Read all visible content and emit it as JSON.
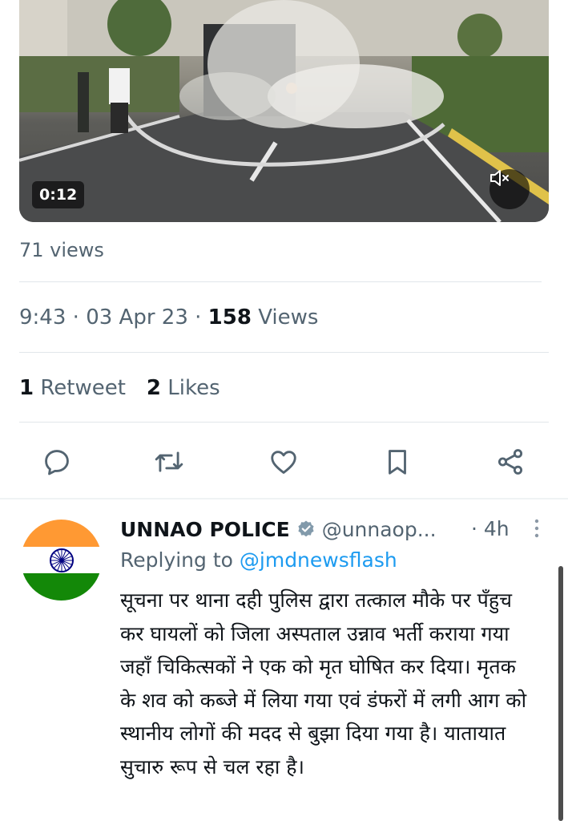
{
  "video": {
    "timer": "0:12",
    "mute_icon": "speaker-muted-icon"
  },
  "views_small": "71 views",
  "tweet_meta": {
    "time": "9:43",
    "sep1": " · ",
    "date": "03 Apr 23",
    "sep2": " · ",
    "views_count": "158",
    "views_label": " Views"
  },
  "stats": {
    "retweets_count": "1",
    "retweets_label": " Retweet",
    "likes_count": "2",
    "likes_label": " Likes"
  },
  "actions": [
    "reply-icon",
    "retweet-icon",
    "like-icon",
    "bookmark-icon",
    "share-icon"
  ],
  "reply_tweet": {
    "author_name": "UNNAO POLICE",
    "handle": "@unnaop...",
    "time": "· 4h",
    "replying_prefix": "Replying to ",
    "replying_to": "@jmdnewsflash",
    "text": "सूचना पर थाना दही पुलिस द्वारा तत्काल मौके पर पँहुच कर घायलों को जिला अस्पताल उन्नाव भर्ती कराया गया जहाँ चिकित्सकों ने एक को मृत घोषित कर दिया। मृतक के शव को कब्जे में लिया गया एवं डंफरों में लगी आग को स्थानीय लोगों की मदद से बुझा दिया गया है। यातायात सुचारु रूप से चल रहा है।"
  },
  "colors": {
    "accent": "#1d9bf0",
    "muted": "#536471",
    "text": "#0f1419",
    "flag_saffron": "#ff9933",
    "flag_green": "#138808",
    "chakra": "#000080"
  }
}
